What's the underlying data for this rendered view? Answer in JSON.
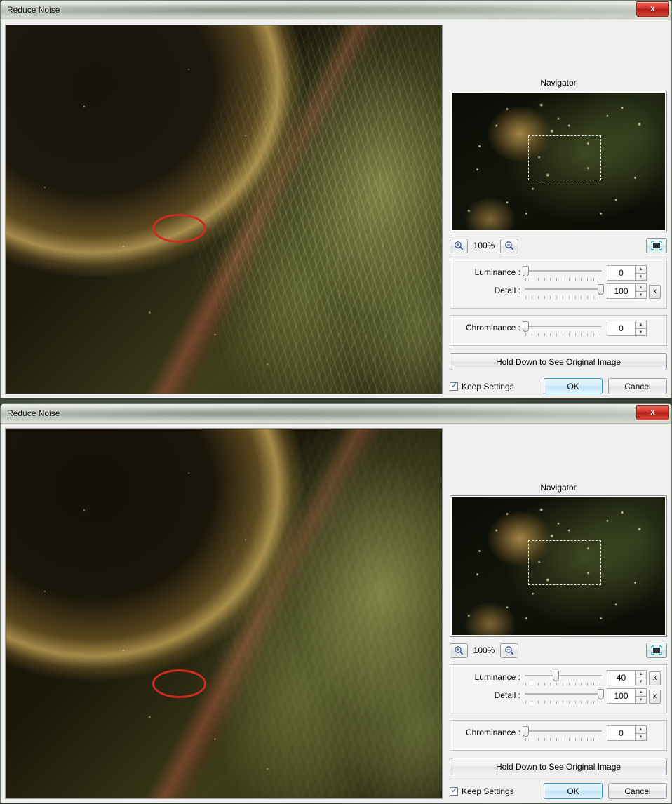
{
  "window": {
    "title": "Reduce Noise",
    "close_label": "x",
    "close_icon": "close-icon"
  },
  "navigator": {
    "title": "Navigator",
    "zoom_in_icon": "zoom-in-icon",
    "zoom_out_icon": "zoom-out-icon",
    "fit_icon": "fit-to-screen-icon",
    "zoom_level": "100%"
  },
  "dialogs": [
    {
      "id": "before",
      "luminance": {
        "label": "Luminance :",
        "value": "0",
        "slider_pct": 0,
        "has_reset": false,
        "reset_label": "x",
        "highlighted": true
      },
      "detail": {
        "label": "Detail :",
        "value": "100",
        "slider_pct": 100,
        "has_reset": true,
        "reset_label": "x",
        "highlighted": false
      },
      "chrominance": {
        "label": "Chrominance :",
        "value": "0",
        "slider_pct": 0,
        "has_reset": false,
        "reset_label": "x",
        "highlighted": false
      },
      "preview_smooth": false
    },
    {
      "id": "after",
      "luminance": {
        "label": "Luminance :",
        "value": "40",
        "slider_pct": 40,
        "has_reset": true,
        "reset_label": "x",
        "highlighted": true
      },
      "detail": {
        "label": "Detail :",
        "value": "100",
        "slider_pct": 100,
        "has_reset": true,
        "reset_label": "x",
        "highlighted": false
      },
      "chrominance": {
        "label": "Chrominance :",
        "value": "0",
        "slider_pct": 0,
        "has_reset": false,
        "reset_label": "x",
        "highlighted": false
      },
      "preview_smooth": true
    }
  ],
  "actions": {
    "hold_original": "Hold Down to See Original Image",
    "keep_settings": "Keep Settings",
    "ok": "OK",
    "cancel": "Cancel"
  },
  "colors": {
    "annotation": "#cf2b20",
    "accent": "#2f9ad1",
    "panel": "#f0f0f0",
    "close_button": "#d4342a"
  }
}
